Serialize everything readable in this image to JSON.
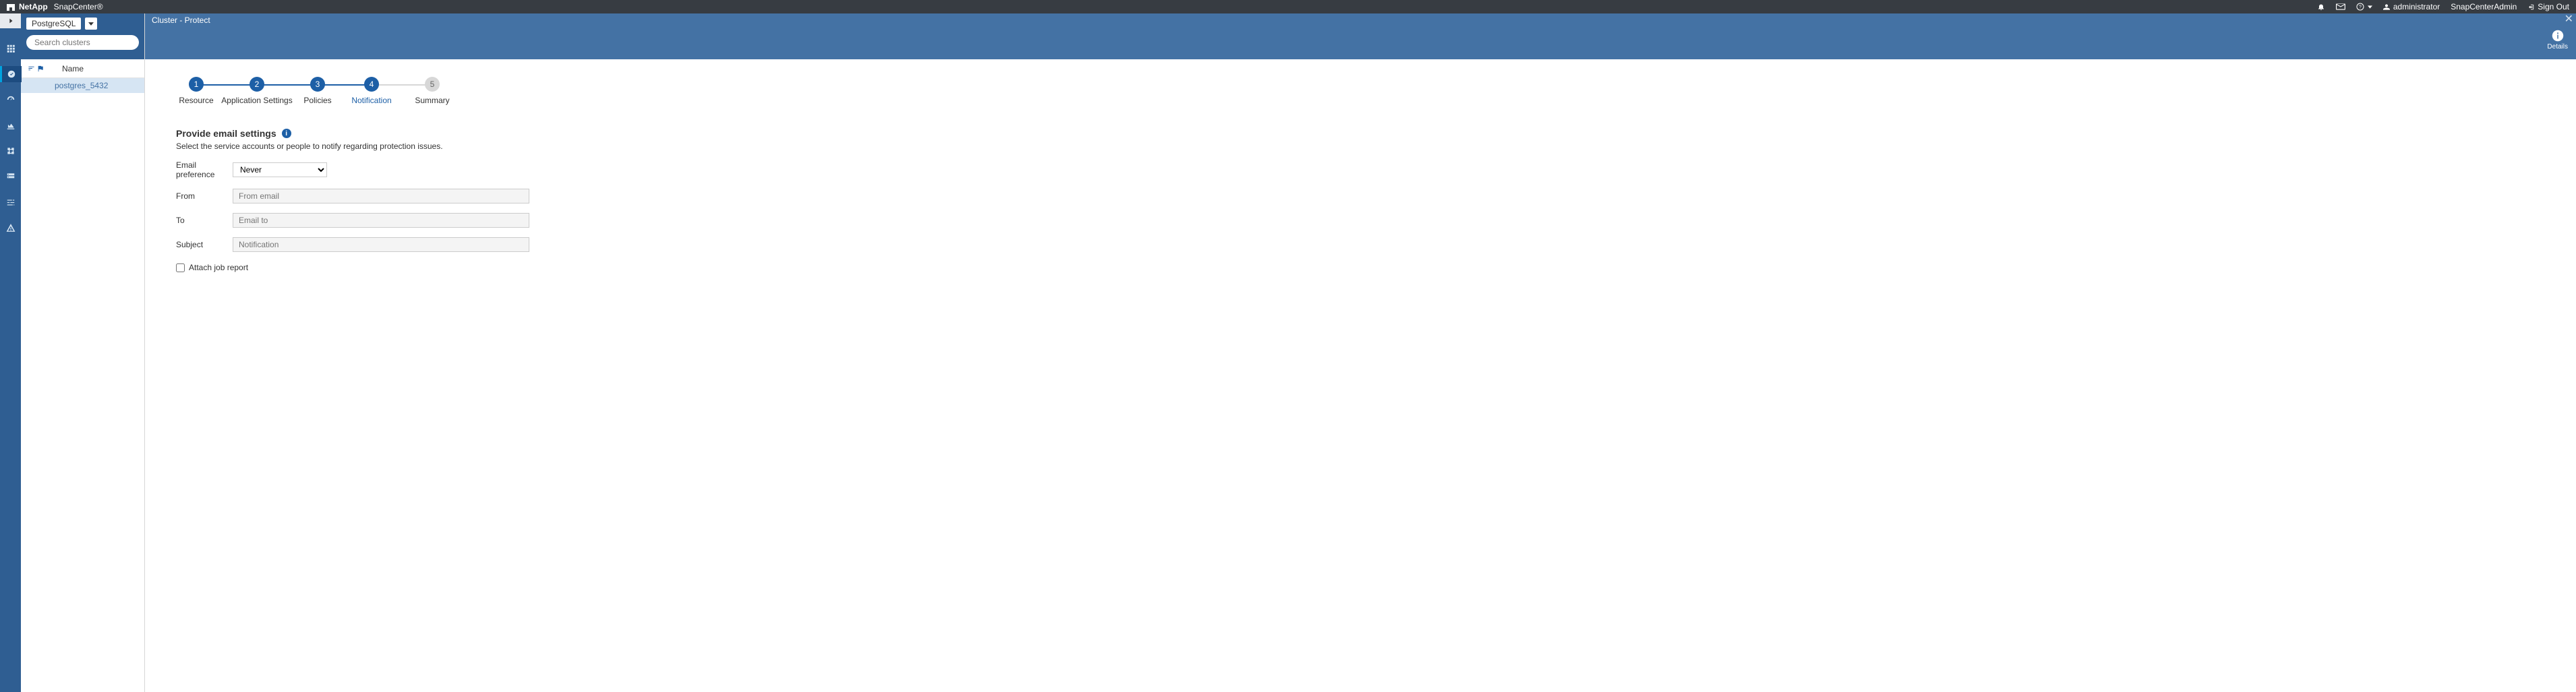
{
  "brand": {
    "company": "NetApp",
    "product": "SnapCenter®"
  },
  "topnav": {
    "user": "administrator",
    "role": "SnapCenterAdmin",
    "signout": "Sign Out"
  },
  "leftpanel": {
    "plugin": "PostgreSQL",
    "search_placeholder": "Search clusters",
    "col_name": "Name",
    "rows": [
      "postgres_5432"
    ]
  },
  "crumb": "Cluster - Protect",
  "details_label": "Details",
  "wizard": {
    "steps": [
      {
        "num": "1",
        "label": "Resource",
        "active": true,
        "current": false
      },
      {
        "num": "2",
        "label": "Application Settings",
        "active": true,
        "current": false
      },
      {
        "num": "3",
        "label": "Policies",
        "active": true,
        "current": false
      },
      {
        "num": "4",
        "label": "Notification",
        "active": true,
        "current": true
      },
      {
        "num": "5",
        "label": "Summary",
        "active": false,
        "current": false
      }
    ]
  },
  "form": {
    "title": "Provide email settings",
    "subtitle": "Select the service accounts or people to notify regarding protection issues.",
    "email_pref_label": "Email preference",
    "email_pref_value": "Never",
    "from_label": "From",
    "from_placeholder": "From email",
    "to_label": "To",
    "to_placeholder": "Email to",
    "subject_label": "Subject",
    "subject_placeholder": "Notification",
    "attach_label": "Attach job report"
  }
}
